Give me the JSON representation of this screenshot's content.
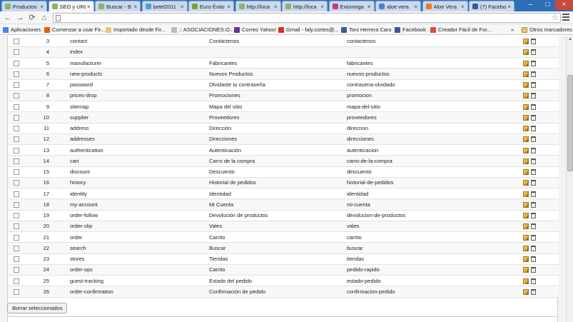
{
  "browser": {
    "tabs": [
      {
        "title": "Productos",
        "color": "#8ab36b"
      },
      {
        "title": "SEO y URL",
        "color": "#8ab36b",
        "active": true
      },
      {
        "title": "Buscar - B",
        "color": "#8ab36b"
      },
      {
        "title": "betel2011",
        "color": "#4aa0d8"
      },
      {
        "title": "Euro Éxito",
        "color": "#7aa22e"
      },
      {
        "title": "http://loca",
        "color": "#8ab36b"
      },
      {
        "title": "http://loca",
        "color": "#8ab36b"
      },
      {
        "title": "Exiomega",
        "color": "#c43b8a"
      },
      {
        "title": "aloe vera",
        "color": "#4a7fd6"
      },
      {
        "title": "Aloe Vera",
        "color": "#f07a21"
      },
      {
        "title": "(7) Facebo",
        "color": "#3b5998"
      }
    ],
    "tab_close_glyph": "×",
    "window_controls": {
      "minimize": "–",
      "maximize": "□",
      "close": "×"
    },
    "nav": {
      "back": "←",
      "forward": "→",
      "reload": "⟳",
      "home": "⌂"
    },
    "address_value": "",
    "star_glyph": "☆",
    "bookmarks": [
      {
        "label": "Aplicaciones",
        "color": "#4285f4"
      },
      {
        "label": "Comenzar a usar Fir...",
        "color": "#e66000"
      },
      {
        "label": "Importado desde Fir...",
        "color": "#e8c66b"
      },
      {
        "label": ":: ASOCIACIONES.O...",
        "color": "#bbbbbb"
      },
      {
        "label": "Correo Yahoo!",
        "color": "#6b2fa0"
      },
      {
        "label": "Gmail - faly.cortes@...",
        "color": "#d93025"
      },
      {
        "label": "Toni Herrera Caro",
        "color": "#3b5998"
      },
      {
        "label": "Facebook",
        "color": "#3b5998"
      },
      {
        "label": "Creador Fácil de For...",
        "color": "#e04a3c"
      }
    ],
    "bookmarks_overflow": "»",
    "other_bookmarks": "Otros marcadores"
  },
  "table": {
    "rows": [
      {
        "id": "3",
        "page": "contact",
        "title": "Contáctenos",
        "url": "contactenos"
      },
      {
        "id": "4",
        "page": "index",
        "title": "",
        "url": ""
      },
      {
        "id": "5",
        "page": "manufacturer",
        "title": "Fabricantes",
        "url": "fabricantes"
      },
      {
        "id": "6",
        "page": "new-products",
        "title": "Nuevos Productos",
        "url": "nuevos-productos"
      },
      {
        "id": "7",
        "page": "password",
        "title": "Olvidaste tu contraseña",
        "url": "contrasena-olvidado"
      },
      {
        "id": "8",
        "page": "prices-drop",
        "title": "Promociones",
        "url": "promocion"
      },
      {
        "id": "9",
        "page": "sitemap",
        "title": "Mapa del sitio",
        "url": "mapa-del-sitio"
      },
      {
        "id": "10",
        "page": "supplier",
        "title": "Proveedores",
        "url": "proveedores"
      },
      {
        "id": "11",
        "page": "address",
        "title": "Dirección",
        "url": "direccion"
      },
      {
        "id": "12",
        "page": "addresses",
        "title": "Direcciones",
        "url": "direcciones"
      },
      {
        "id": "13",
        "page": "authentication",
        "title": "Autenticación",
        "url": "autenticacion"
      },
      {
        "id": "14",
        "page": "cart",
        "title": "Carro de la compra",
        "url": "carro-de-la-compra"
      },
      {
        "id": "15",
        "page": "discount",
        "title": "Descuento",
        "url": "descuento"
      },
      {
        "id": "16",
        "page": "history",
        "title": "Historial de pedidos",
        "url": "historial-de-pedidos"
      },
      {
        "id": "17",
        "page": "identity",
        "title": "Identidad",
        "url": "identidad"
      },
      {
        "id": "18",
        "page": "my-account",
        "title": "Mi Cuenta",
        "url": "mi-cuenta"
      },
      {
        "id": "19",
        "page": "order-follow",
        "title": "Devolución de productos",
        "url": "devolucion-de-productos"
      },
      {
        "id": "20",
        "page": "order-slip",
        "title": "Vales",
        "url": "vales"
      },
      {
        "id": "21",
        "page": "order",
        "title": "Carrito",
        "url": "carrito"
      },
      {
        "id": "22",
        "page": "search",
        "title": "Buscar",
        "url": "buscar"
      },
      {
        "id": "23",
        "page": "stores",
        "title": "Tiendas",
        "url": "tiendas"
      },
      {
        "id": "24",
        "page": "order-opc",
        "title": "Carrito",
        "url": "pedido-rapido"
      },
      {
        "id": "25",
        "page": "guest-tracking",
        "title": "Estado del pedido",
        "url": "estado-pedido"
      },
      {
        "id": "26",
        "page": "order-confirmation",
        "title": "Confirmación de pedido",
        "url": "confirmacion-pedido"
      }
    ]
  },
  "actions": {
    "bulk_delete_label": "Borrar seleccionados"
  }
}
